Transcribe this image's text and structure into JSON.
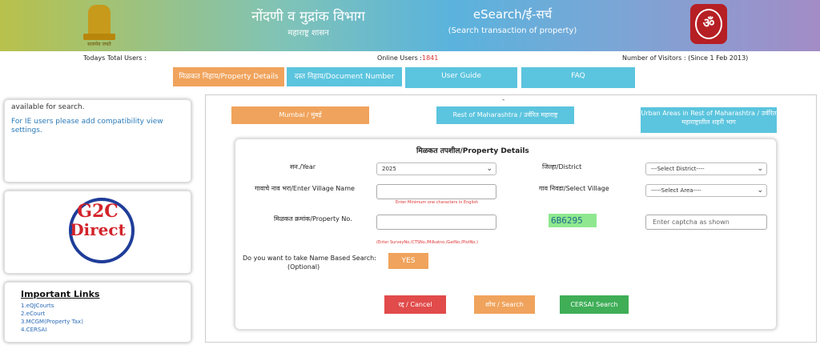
{
  "header": {
    "emblem_text": "सत्यमेव जयते",
    "dept_title": "नोंदणी व मुद्रांक विभाग",
    "dept_subtitle": "महाराष्ट्र शासन",
    "app_title": "eSearch/ई-सर्च",
    "app_subtitle": "(Search transaction of property)"
  },
  "infobar": {
    "total_users_label": "Todays Total Users :",
    "online_users_label": "Online Users :",
    "online_users_value": "1841",
    "visitors_label": "Number of Visitors : (Since 1 Feb 2013)"
  },
  "menu": {
    "property_details": "मिळकत निहाय/Property Details",
    "document_number": "दस्त निहाय/Document Number",
    "user_guide": "User Guide",
    "faq": "FAQ"
  },
  "left": {
    "notice_line1": "available for search.",
    "notice_line2": "For IE users please add compatibility view settings.",
    "g2c_line1": "G2C",
    "g2c_line2": "Direct",
    "links_heading": "Important Links",
    "links": [
      "1.eQJCourts",
      "2.eCourt",
      "3.MCGM(Property Tax)",
      "4.CERSAI"
    ]
  },
  "regions": {
    "mumbai": "Mumbai / मुंबई",
    "rest": "Rest of Maharashtra / उर्वरित महाराष्ट्र",
    "urban": "Urban Areas in Rest of Maharashtra / उर्वरित महाराष्ट्रातील शहरी भाग",
    "dash": "-"
  },
  "form": {
    "title": "मिळकत तपशील/Property Details",
    "year_label": "सन./Year",
    "year_value": "2025",
    "district_label": "जिल्हा/District",
    "district_value": "---Select District----",
    "village_label": "गावाचे नाव भरा/Enter Village Name",
    "village_hint": "Enter Minimum one characters in English",
    "select_village_label": "गाव निवडा/Select Village",
    "area_value": "-----Select Area----",
    "property_label": "मिळकत क्रमांक/Property No.",
    "property_hint": "(Enter SurveyNo./CTSNo./Milkatno./GatNo./PlotNo.)",
    "captcha_code": "6B6295",
    "captcha_placeholder": "Enter captcha as shown",
    "name_search_label1": "Do you want to take Name Based Search:",
    "name_search_label2": "(Optional)",
    "yes_label": "YES",
    "cancel_label": "रद्द / Cancel",
    "search_label": "शोध / Search",
    "cersai_label": "CERSAI Search"
  }
}
